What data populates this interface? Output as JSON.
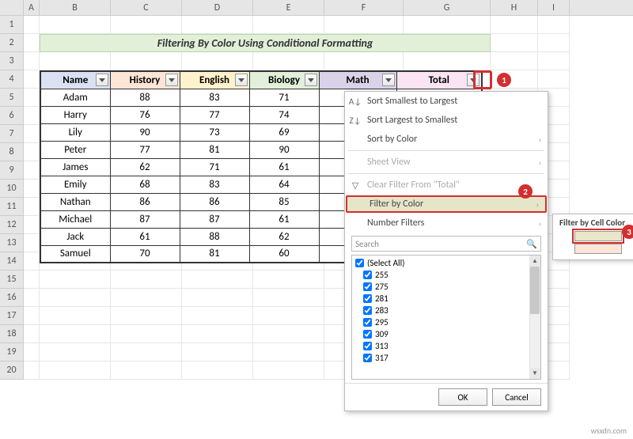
{
  "columns": [
    "A",
    "B",
    "C",
    "D",
    "E",
    "F",
    "G",
    "H",
    "I"
  ],
  "rows": [
    "1",
    "2",
    "3",
    "4",
    "5",
    "6",
    "7",
    "8",
    "9",
    "10",
    "11",
    "12",
    "13",
    "14",
    "15",
    "16",
    "17",
    "18",
    "19",
    "20"
  ],
  "title": "Filtering By Color Using Conditional Formatting",
  "headers": {
    "name": "Name",
    "history": "History",
    "english": "English",
    "biology": "Biology",
    "math": "Math",
    "total": "Total"
  },
  "data": [
    {
      "name": "Adam",
      "history": "88",
      "english": "83",
      "biology": "71"
    },
    {
      "name": "Harry",
      "history": "76",
      "english": "77",
      "biology": "74"
    },
    {
      "name": "Lily",
      "history": "90",
      "english": "73",
      "biology": "69"
    },
    {
      "name": "Peter",
      "history": "77",
      "english": "81",
      "biology": "90"
    },
    {
      "name": "James",
      "history": "62",
      "english": "71",
      "biology": "61"
    },
    {
      "name": "Emily",
      "history": "68",
      "english": "83",
      "biology": "64"
    },
    {
      "name": "Nathan",
      "history": "86",
      "english": "86",
      "biology": "85"
    },
    {
      "name": "Michael",
      "history": "87",
      "english": "87",
      "biology": "61"
    },
    {
      "name": "Jack",
      "history": "61",
      "english": "88",
      "biology": "62"
    },
    {
      "name": "Samuel",
      "history": "70",
      "english": "81",
      "biology": "60"
    }
  ],
  "menu": {
    "sort_asc": "Sort Smallest to Largest",
    "sort_desc": "Sort Largest to Smallest",
    "sort_color": "Sort by Color",
    "sheet_view": "Sheet View",
    "clear": "Clear Filter From \"Total\"",
    "filter_color": "Filter by Color",
    "num_filters": "Number Filters",
    "search": "Search",
    "select_all": "(Select All)",
    "items": [
      "255",
      "275",
      "281",
      "283",
      "295",
      "309",
      "313",
      "317"
    ],
    "ok": "OK",
    "cancel": "Cancel"
  },
  "submenu": {
    "title": "Filter by Cell Color",
    "colors": [
      "#e9e6c9",
      "#fce4d6"
    ]
  },
  "badges": {
    "b1": "1",
    "b2": "2",
    "b3": "3"
  },
  "watermark": "wsxdn.com"
}
